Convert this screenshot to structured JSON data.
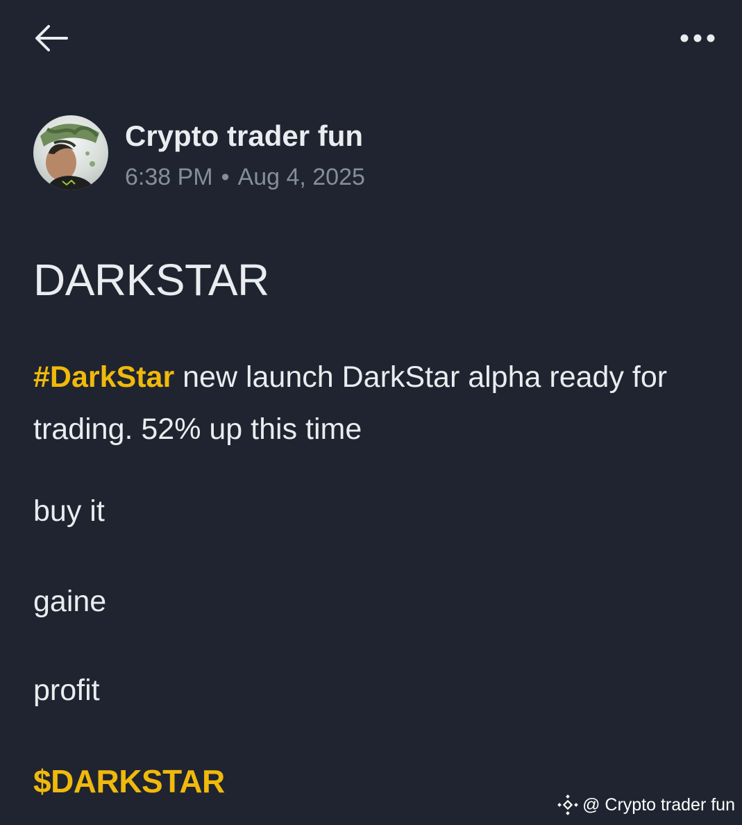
{
  "header": {
    "back_icon": "arrow-left-icon",
    "more_icon": "more-dots-icon"
  },
  "author": {
    "name": "Crypto trader fun",
    "time": "6:38 PM",
    "separator": "•",
    "date": "Aug 4, 2025"
  },
  "post": {
    "title": "DARKSTAR",
    "hashtag": "#DarkStar",
    "body_text": " new launch DarkStar alpha ready for trading. 52% up this time",
    "line_1": "buy it",
    "line_2": "gaine",
    "line_3": "profit",
    "cashtag": "$DARKSTAR"
  },
  "watermark": {
    "icon": "binance-logo-icon",
    "text": "@ Crypto trader fun"
  },
  "colors": {
    "background": "#1f2430",
    "accent": "#f0b90b",
    "text_primary": "#eaecef",
    "text_secondary": "#848e9c"
  }
}
